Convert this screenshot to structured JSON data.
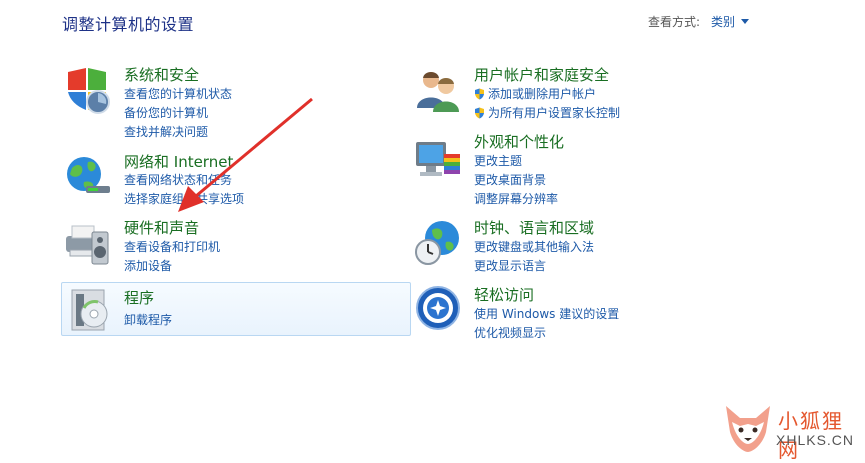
{
  "header": {
    "title": "调整计算机的设置",
    "view_by_label": "查看方式:",
    "view_by_value": "类别"
  },
  "categories": [
    {
      "title": "系统和安全",
      "icon": "shield-globe-icon",
      "links": [
        "查看您的计算机状态",
        "备份您的计算机",
        "查找并解决问题"
      ]
    },
    {
      "title": "网络和 Internet",
      "icon": "network-globe-icon",
      "links": [
        "查看网络状态和任务",
        "选择家庭组和共享选项"
      ]
    },
    {
      "title": "硬件和声音",
      "icon": "printer-speaker-icon",
      "links": [
        "查看设备和打印机",
        "添加设备"
      ]
    },
    {
      "title": "程序",
      "icon": "programs-disc-icon",
      "links": [
        "卸载程序"
      ]
    },
    {
      "title": "用户帐户和家庭安全",
      "icon": "users-icon",
      "links": [
        "添加或删除用户帐户",
        "为所有用户设置家长控制"
      ]
    },
    {
      "title": "外观和个性化",
      "icon": "monitor-palette-icon",
      "links": [
        "更改主题",
        "更改桌面背景",
        "调整屏幕分辨率"
      ]
    },
    {
      "title": "时钟、语言和区域",
      "icon": "clock-globe-icon",
      "links": [
        "更改键盘或其他输入法",
        "更改显示语言"
      ]
    },
    {
      "title": "轻松访问",
      "icon": "ease-of-access-icon",
      "links": [
        "使用 Windows 建议的设置",
        "优化视频显示"
      ]
    }
  ],
  "watermark": {
    "name": "小狐狸网",
    "domain": "XHLKS.CN"
  },
  "colors": {
    "title_green": "#196e22",
    "link_blue": "#1e5aa8",
    "header_blue": "#1e3287",
    "annotation_red": "#e0302a"
  }
}
